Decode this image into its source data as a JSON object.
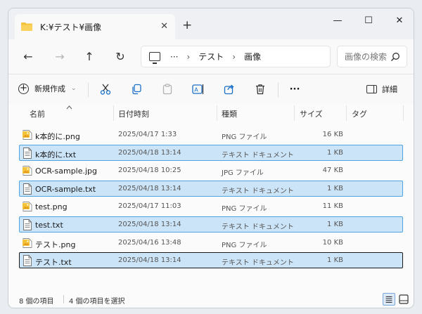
{
  "window": {
    "tab_title": "K:¥テスト¥画像",
    "tab_close": "✕",
    "tab_add": "+",
    "minimize": "—",
    "maximize": "☐",
    "close": "✕"
  },
  "nav": {
    "back": "←",
    "forward": "→",
    "up": "↑",
    "refresh": "↻",
    "address_more": "···",
    "sep": "›",
    "breadcrumb": [
      "テスト",
      "画像"
    ],
    "search_placeholder": "画像の検索"
  },
  "toolbar": {
    "new_label": "新規作成",
    "new_chevron": "⌄",
    "more": "···",
    "details_label": "詳細"
  },
  "columns": {
    "name": "名前",
    "date": "日付時刻",
    "type": "種類",
    "size": "サイズ",
    "tag": "タグ"
  },
  "files": [
    {
      "name": "k本的に.png",
      "date": "2025/04/17 1:33",
      "type": "PNG ファイル",
      "size": "16 KB",
      "icon": "image-file-icon",
      "state": "none"
    },
    {
      "name": "k本的に.txt",
      "date": "2025/04/18 13:14",
      "type": "テキスト ドキュメント",
      "size": "1 KB",
      "icon": "text-file-icon",
      "state": "selected"
    },
    {
      "name": "OCR-sample.jpg",
      "date": "2025/04/18 10:25",
      "type": "JPG ファイル",
      "size": "47 KB",
      "icon": "image-file-icon",
      "state": "none"
    },
    {
      "name": "OCR-sample.txt",
      "date": "2025/04/18 13:14",
      "type": "テキスト ドキュメント",
      "size": "1 KB",
      "icon": "text-file-icon",
      "state": "selected"
    },
    {
      "name": "test.png",
      "date": "2025/04/17 11:03",
      "type": "PNG ファイル",
      "size": "11 KB",
      "icon": "image-file-icon",
      "state": "none"
    },
    {
      "name": "test.txt",
      "date": "2025/04/18 13:14",
      "type": "テキスト ドキュメント",
      "size": "1 KB",
      "icon": "text-file-icon",
      "state": "selected"
    },
    {
      "name": "テスト.png",
      "date": "2025/04/16 13:48",
      "type": "PNG ファイル",
      "size": "10 KB",
      "icon": "image-file-icon",
      "state": "none"
    },
    {
      "name": "テスト.txt",
      "date": "2025/04/18 13:14",
      "type": "テキスト ドキュメント",
      "size": "1 KB",
      "icon": "text-file-icon",
      "state": "focused"
    }
  ],
  "status": {
    "item_count": "8 個の項目",
    "selected_count": "4 個の項目を選択"
  },
  "colors": {
    "selection_bg": "#cce4f7",
    "selection_border": "#4fa3e0",
    "folder": "#f3c33b"
  }
}
